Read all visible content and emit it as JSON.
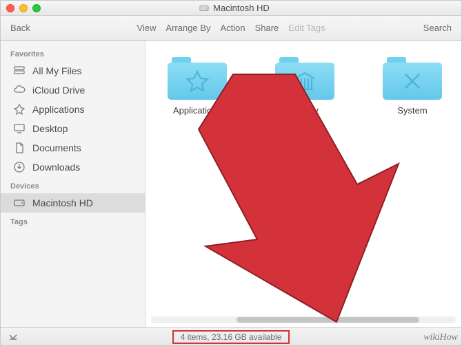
{
  "window": {
    "title": "Macintosh HD"
  },
  "toolbar": {
    "back": "Back",
    "view": "View",
    "arrange": "Arrange By",
    "action": "Action",
    "share": "Share",
    "edit_tags": "Edit Tags",
    "search": "Search"
  },
  "sidebar": {
    "headers": {
      "favorites": "Favorites",
      "devices": "Devices",
      "tags": "Tags"
    },
    "favorites": [
      {
        "label": "All My Files"
      },
      {
        "label": "iCloud Drive"
      },
      {
        "label": "Applications"
      },
      {
        "label": "Desktop"
      },
      {
        "label": "Documents"
      },
      {
        "label": "Downloads"
      }
    ],
    "devices": [
      {
        "label": "Macintosh HD"
      }
    ]
  },
  "content": {
    "items": [
      {
        "name": "Applications",
        "glyph": "apps"
      },
      {
        "name": "Library",
        "glyph": "library"
      },
      {
        "name": "System",
        "glyph": "system"
      }
    ]
  },
  "status": {
    "text": "4 items, 23.16 GB available"
  },
  "annotation": {
    "arrow_color": "#d4323a"
  },
  "watermark": "wikiHow"
}
